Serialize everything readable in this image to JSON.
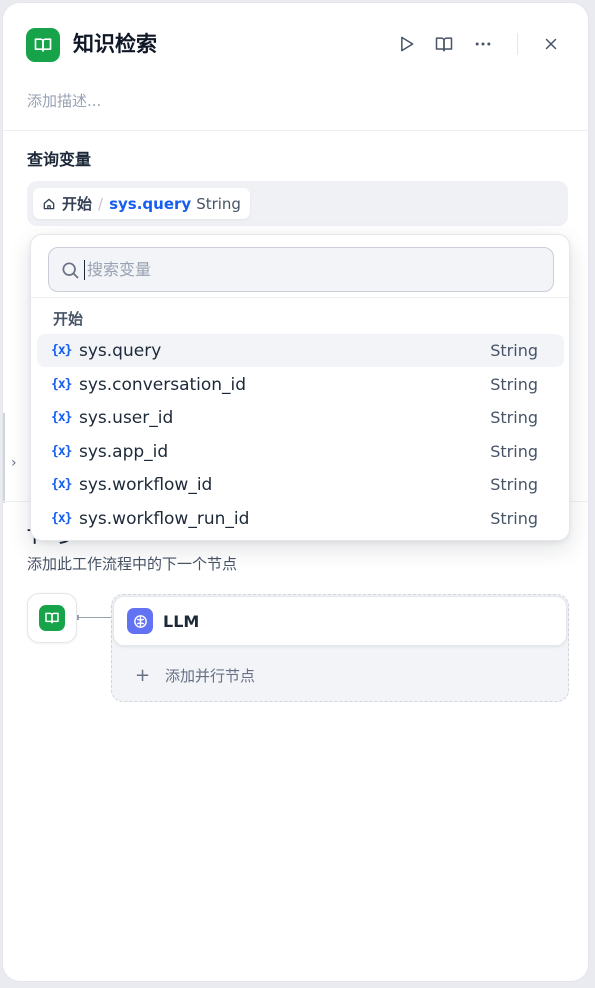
{
  "header": {
    "title": "知识检索",
    "description_placeholder": "添加描述..."
  },
  "query_section": {
    "title": "查询变量",
    "selected": {
      "node": "开始",
      "separator": "/",
      "variable": "sys.query",
      "type": "String"
    }
  },
  "dropdown": {
    "search_placeholder": "搜索变量",
    "group_title": "开始",
    "options": [
      {
        "icon": "{x}",
        "name": "sys.query",
        "type": "String"
      },
      {
        "icon": "{x}",
        "name": "sys.conversation_id",
        "type": "String"
      },
      {
        "icon": "{x}",
        "name": "sys.user_id",
        "type": "String"
      },
      {
        "icon": "{x}",
        "name": "sys.app_id",
        "type": "String"
      },
      {
        "icon": "{x}",
        "name": "sys.workflow_id",
        "type": "String"
      },
      {
        "icon": "{x}",
        "name": "sys.workflow_run_id",
        "type": "String"
      }
    ]
  },
  "next_step": {
    "title": "下一步",
    "description": "添加此工作流程中的下一个节点",
    "next_node_label": "LLM",
    "add_parallel_label": "添加并行节点"
  },
  "colors": {
    "knowledge_green": "#16a34a",
    "llm_indigo": "#6172f3",
    "accent_blue": "#155eef"
  },
  "icons": {
    "node": "book-open-icon",
    "run": "play-icon",
    "docs": "book-icon",
    "more": "more-horizontal-icon",
    "close": "close-icon",
    "search": "search-icon",
    "home": "home-icon",
    "variable": "variable-icon",
    "llm": "llm-brain-icon",
    "add": "plus-icon"
  }
}
